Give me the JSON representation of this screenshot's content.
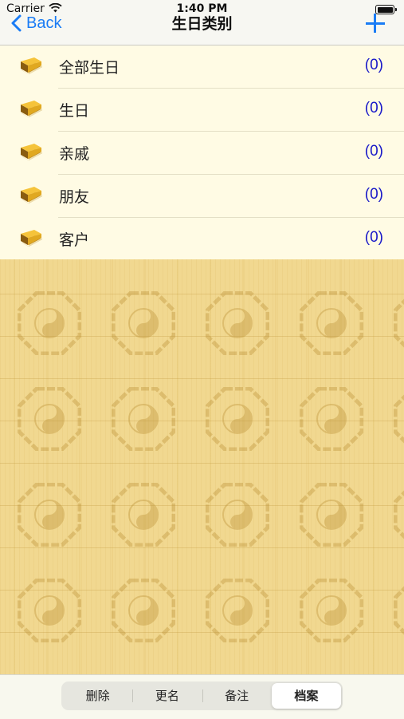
{
  "status_bar": {
    "carrier": "Carrier",
    "time": "1:40 PM"
  },
  "nav": {
    "back_label": "Back",
    "title": "生日类别"
  },
  "categories": [
    {
      "label": "全部生日",
      "count": "(0)"
    },
    {
      "label": "生日",
      "count": "(0)"
    },
    {
      "label": "亲戚",
      "count": "(0)"
    },
    {
      "label": "朋友",
      "count": "(0)"
    },
    {
      "label": "客户",
      "count": "(0)"
    }
  ],
  "segments": [
    {
      "label": "删除"
    },
    {
      "label": "更名"
    },
    {
      "label": "备注"
    },
    {
      "label": "档案",
      "selected": true
    }
  ],
  "colors": {
    "accent": "#1a7cf5",
    "count": "#1a1ac8",
    "list_bg": "#fffbe4",
    "paper": "#f1d890"
  }
}
